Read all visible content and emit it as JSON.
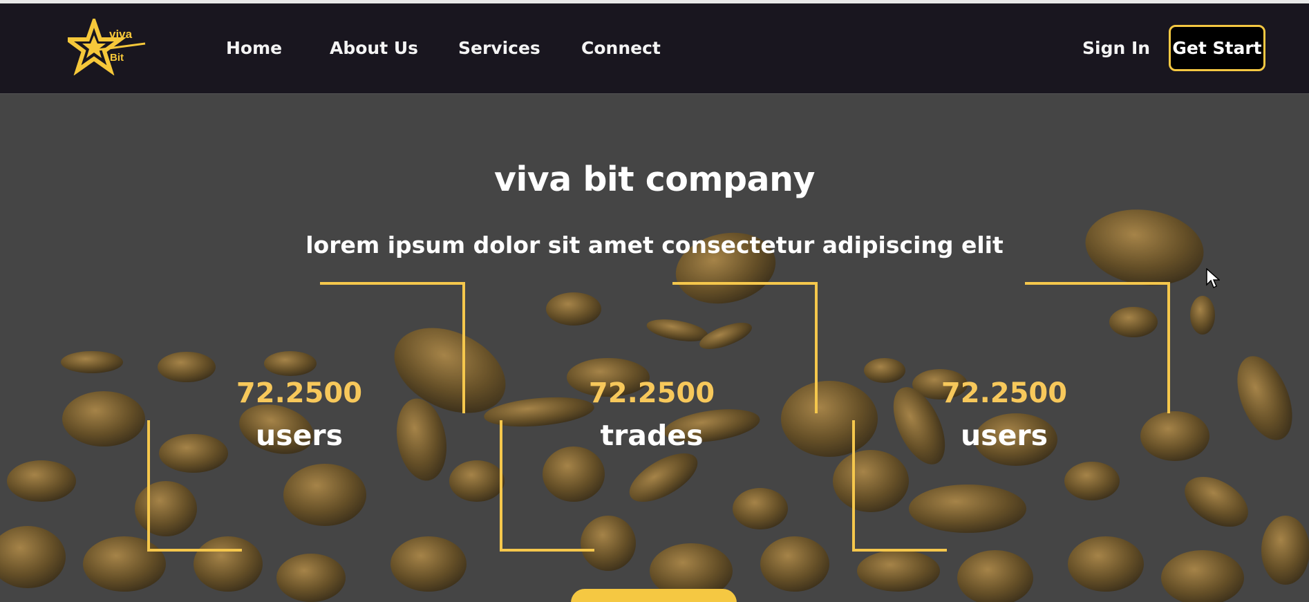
{
  "brand": {
    "logo_top": "viva",
    "logo_bottom": "Bit"
  },
  "nav": {
    "links": [
      "Home",
      "About Us",
      "Services",
      "Connect"
    ],
    "sign_in": "Sign In",
    "get_start": "Get Start"
  },
  "hero": {
    "title": "viva bit company",
    "subtitle": "lorem ipsum dolor sit amet consectetur adipiscing elit"
  },
  "stats": [
    {
      "value": "72.2500",
      "label": "users"
    },
    {
      "value": "72.2500",
      "label": "trades"
    },
    {
      "value": "72.2500",
      "label": "users"
    }
  ],
  "colors": {
    "accent": "#f5c842",
    "navbar_bg": "#19161f",
    "hero_bg": "#454545"
  },
  "icons": [
    "star-logo-icon",
    "mouse-cursor-icon"
  ]
}
